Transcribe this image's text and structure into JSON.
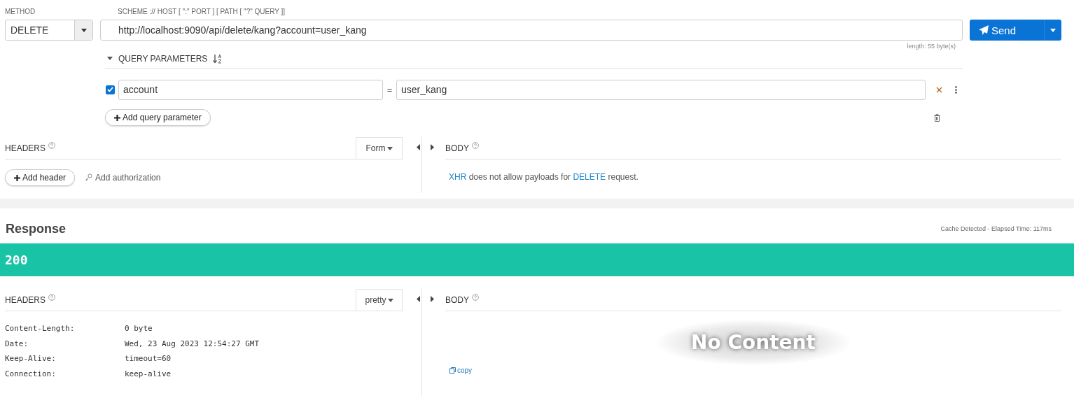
{
  "request": {
    "method_label": "METHOD",
    "method": "DELETE",
    "url_label": "SCHEME :// HOST [ \":\" PORT ] [ PATH [ \"?\" QUERY ]]",
    "url": "http://localhost:9090/api/delete/kang?account=user_kang",
    "url_length": "length: 55 byte(s)",
    "send_button": "Send",
    "query_parameters": {
      "title": "QUERY PARAMETERS",
      "expanded": true,
      "add_button": "Add query parameter",
      "params": [
        {
          "key": "account",
          "separator": "=",
          "value": "user_kang",
          "enabled": true
        }
      ]
    },
    "headers": {
      "title": "HEADERS",
      "mode": "Form",
      "add_header": "Add header",
      "add_authorization": "Add authorization"
    },
    "body": {
      "title": "BODY",
      "message": [
        {
          "text": "XHR",
          "kind": "link"
        },
        {
          "text": " does not allow payloads for ",
          "kind": "plain"
        },
        {
          "text": "DELETE",
          "kind": "link"
        },
        {
          "text": " request.",
          "kind": "plain"
        }
      ]
    }
  },
  "response": {
    "title": "Response",
    "meta": "Cache Detected - Elapsed Time: 117ms",
    "status": "200",
    "headers": {
      "title": "HEADERS",
      "mode": "pretty",
      "rows": [
        {
          "name": "Content-Length:",
          "value": "0 byte"
        },
        {
          "name": "Date:",
          "value": "Wed, 23 Aug 2023 12:54:27 GMT"
        },
        {
          "name": "Keep-Alive:",
          "value": "timeout=60"
        },
        {
          "name": "Connection:",
          "value": "keep-alive"
        }
      ]
    },
    "body": {
      "title": "BODY",
      "empty_text": "No Content",
      "copy_link": "copy"
    }
  }
}
